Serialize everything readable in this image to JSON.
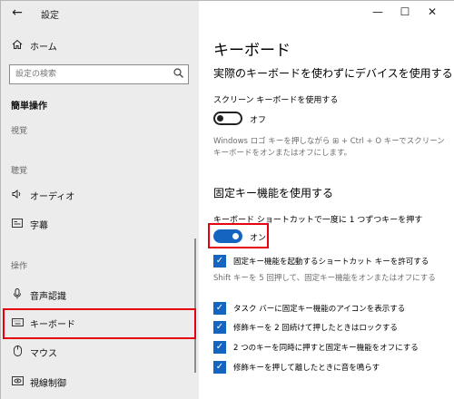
{
  "window": {
    "title": "設定",
    "back_glyph": "←",
    "minimize_glyph": "—",
    "maximize_glyph": "☐",
    "close_glyph": "✕"
  },
  "sidebar": {
    "home": {
      "label": "ホーム",
      "icon": "home-icon"
    },
    "search": {
      "placeholder": "設定の検索",
      "icon": "search-icon"
    },
    "section_title": "簡単操作",
    "groups": {
      "vision": "視覚",
      "hearing": "聴覚",
      "interaction": "操作"
    },
    "items": {
      "audio": {
        "label": "オーディオ",
        "icon": "speaker-icon"
      },
      "captions": {
        "label": "字幕",
        "icon": "captions-icon"
      },
      "speech": {
        "label": "音声認識",
        "icon": "microphone-icon"
      },
      "keyboard": {
        "label": "キーボード",
        "icon": "keyboard-icon"
      },
      "mouse": {
        "label": "マウス",
        "icon": "mouse-icon"
      },
      "eye_control": {
        "label": "視線制御",
        "icon": "eye-icon"
      }
    }
  },
  "content": {
    "page_title": "キーボード",
    "section1": {
      "title": "実際のキーボードを使わずにデバイスを使用する",
      "setting_label": "スクリーン キーボードを使用する",
      "toggle_state": "オフ",
      "description": "Windows ロゴ キーを押しながら ⊞ + Ctrl + O キーでスクリーン キーボードをオンまたはオフにします。"
    },
    "section2": {
      "title": "固定キー機能を使用する",
      "setting_label": "キーボード ショートカットで一度に 1 つずつキーを押す",
      "toggle_state": "オン",
      "options": [
        {
          "label": "固定キー機能を起動するショートカット キーを許可する",
          "checked": true
        },
        {
          "label": "タスク バーに固定キー機能のアイコンを表示する",
          "checked": true
        },
        {
          "label": "修飾キーを 2 回続けて押したときはロックする",
          "checked": true
        },
        {
          "label": "2 つのキーを同時に押すと固定キー機能をオフにする",
          "checked": true
        },
        {
          "label": "修飾キーを押して離したときに音を鳴らす",
          "checked": true
        }
      ],
      "shortcut_description": "Shift キーを 5 回押して、固定キー機能をオンまたはオフにする",
      "check_glyph": "✓"
    }
  },
  "colors": {
    "accent": "#1565c0",
    "highlight_border": "#e60012",
    "sidebar_bg": "#ececec"
  }
}
